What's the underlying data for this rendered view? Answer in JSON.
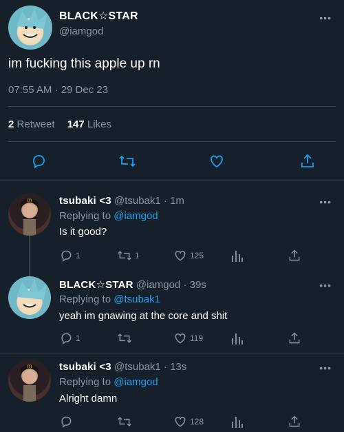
{
  "tweet": {
    "name": "BLACK☆STAR",
    "handle": "@iamgod",
    "text": "im fucking this apple up rn",
    "time": "07:55 AM · 29 Dec 23",
    "retweets": "2",
    "retweets_label": "Retweet",
    "likes": "147",
    "likes_label": "Likes"
  },
  "replies": [
    {
      "name": "tsubaki <3",
      "handle": "@tsubak1",
      "ago": "· 1m",
      "replying_prefix": "Replying to",
      "replying_to": "@iamgod",
      "text": "Is it good?",
      "reply_count": "1",
      "retweet_count": "1",
      "like_count": "125"
    },
    {
      "name": "BLACK☆STAR",
      "handle": "@iamgod",
      "ago": "· 39s",
      "replying_prefix": "Replying to",
      "replying_to": "@tsubak1",
      "text": "yeah im gnawing at the core and shit",
      "reply_count": "1",
      "retweet_count": "",
      "like_count": "119"
    },
    {
      "name": "tsubaki <3",
      "handle": "@tsubak1",
      "ago": "· 13s",
      "replying_prefix": "Replying to",
      "replying_to": "@iamgod",
      "text": "Alright damn",
      "reply_count": "",
      "retweet_count": "",
      "like_count": "128"
    }
  ],
  "colors": {
    "background": "#15202b",
    "muted": "#8899a6",
    "accent": "#1da1f2",
    "divider": "#38444d"
  },
  "icons": [
    "reply-icon",
    "retweet-icon",
    "like-icon",
    "share-icon",
    "analytics-icon",
    "more-icon"
  ]
}
